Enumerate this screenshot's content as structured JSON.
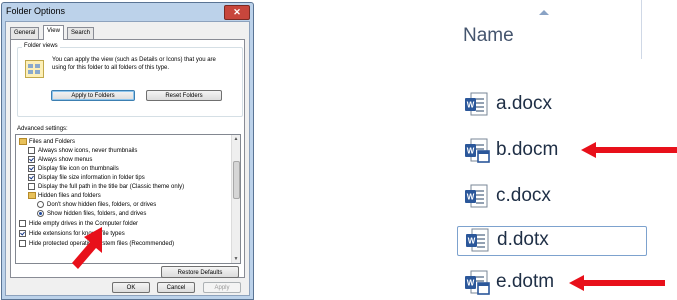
{
  "dialog": {
    "title": "Folder Options",
    "close_label": "✕",
    "tabs": [
      "General",
      "View",
      "Search"
    ],
    "active_tab": "View",
    "folder_views": {
      "label": "Folder views",
      "text": "You can apply the view (such as Details or Icons) that you are using for this folder to all folders of this type.",
      "apply_button": "Apply to Folders",
      "reset_button": "Reset Folders"
    },
    "advanced": {
      "label": "Advanced settings:",
      "items": [
        {
          "type": "folder",
          "label": "Files and Folders"
        },
        {
          "type": "checkbox",
          "checked": false,
          "label": "Always show icons, never thumbnails"
        },
        {
          "type": "checkbox",
          "checked": true,
          "label": "Always show menus"
        },
        {
          "type": "checkbox",
          "checked": true,
          "label": "Display file icon on thumbnails"
        },
        {
          "type": "checkbox",
          "checked": true,
          "label": "Display file size information in folder tips"
        },
        {
          "type": "checkbox",
          "checked": false,
          "label": "Display the full path in the title bar (Classic theme only)"
        },
        {
          "type": "folder",
          "label": "Hidden files and folders"
        },
        {
          "type": "radio",
          "checked": false,
          "label": "Don't show hidden files, folders, or drives"
        },
        {
          "type": "radio",
          "checked": true,
          "label": "Show hidden files, folders, and drives"
        },
        {
          "type": "checkbox",
          "checked": false,
          "label": "Hide empty drives in the Computer folder"
        },
        {
          "type": "checkbox",
          "checked": true,
          "label": "Hide extensions for known file types"
        },
        {
          "type": "checkbox",
          "checked": false,
          "label": "Hide protected operating system files (Recommended)"
        }
      ],
      "restore_button": "Restore Defaults"
    },
    "footer": {
      "ok": "OK",
      "cancel": "Cancel",
      "apply": "Apply"
    }
  },
  "explorer": {
    "column_header": "Name",
    "files": [
      {
        "name": "a.docx",
        "icon": "word-document-icon",
        "arrow": false
      },
      {
        "name": "b.docm",
        "icon": "word-macro-document-icon",
        "arrow": true
      },
      {
        "name": "c.docx",
        "icon": "word-document-icon",
        "arrow": false
      },
      {
        "name": "d.dotx",
        "icon": "word-template-icon",
        "arrow": false
      },
      {
        "name": "e.dotm",
        "icon": "word-macro-template-icon",
        "arrow": true
      }
    ]
  },
  "colors": {
    "arrow": "#e8101a",
    "word_blue": "#2b579a",
    "dialog_frame": "#bcd2ea"
  }
}
